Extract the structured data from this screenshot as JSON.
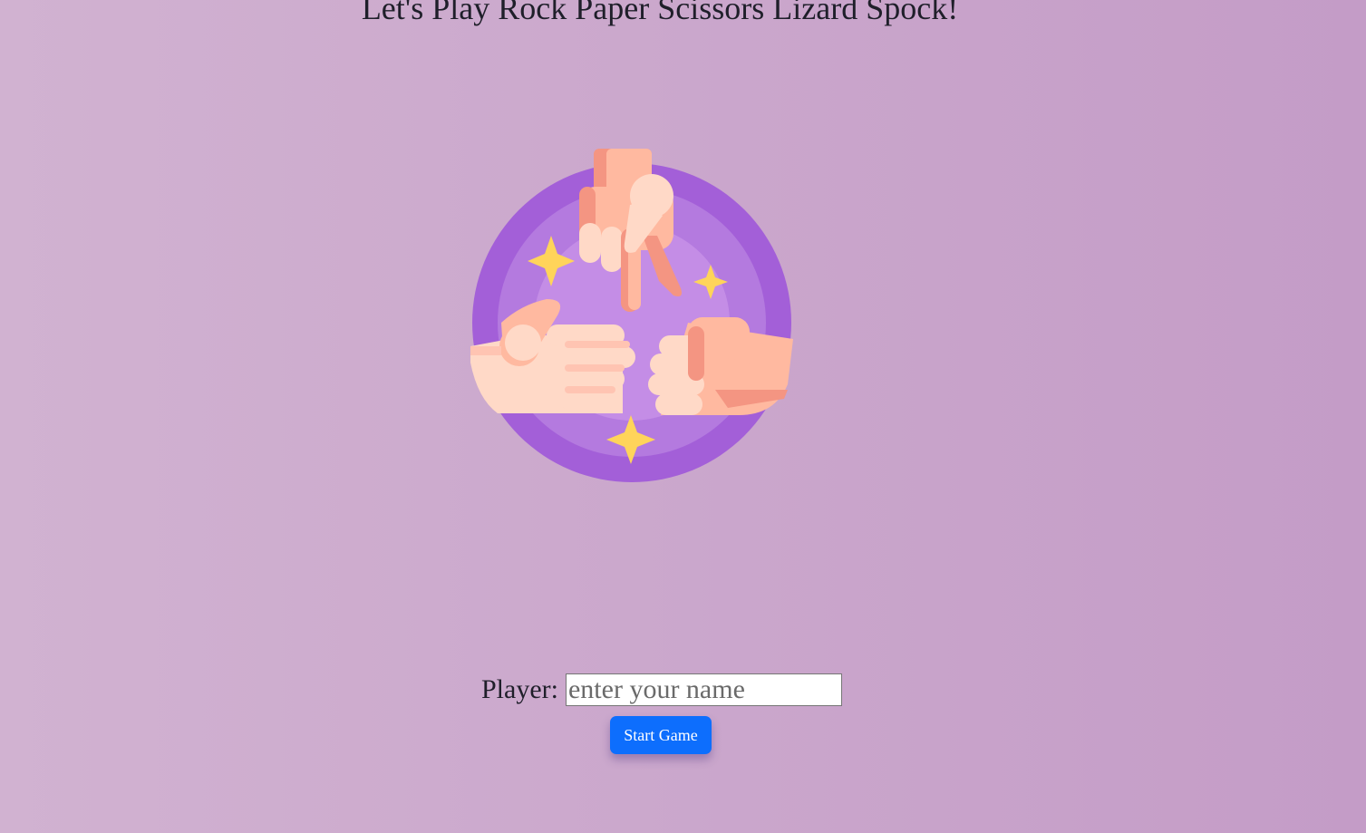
{
  "header": {
    "title": "Let's Play Rock Paper Scissors Lizard Spock!"
  },
  "hero": {
    "icon": "rock-paper-scissors-hands-icon",
    "colors": {
      "outer_ring": "#a35fd8",
      "mid_ring": "#b47adf",
      "inner": "#c48de6",
      "skin_light": "#ffd9c7",
      "skin_mid": "#ffb9a0",
      "skin_dark": "#f49582",
      "star": "#ffd45a",
      "star_shade": "#f9bf3b"
    }
  },
  "form": {
    "player_label": "Player:",
    "player_placeholder": "enter your name",
    "player_value": "",
    "start_label": "Start Game"
  },
  "theme": {
    "bg_left": "#d1b2d1",
    "bg_right": "#c49cc7",
    "button": "#0d6efd"
  }
}
